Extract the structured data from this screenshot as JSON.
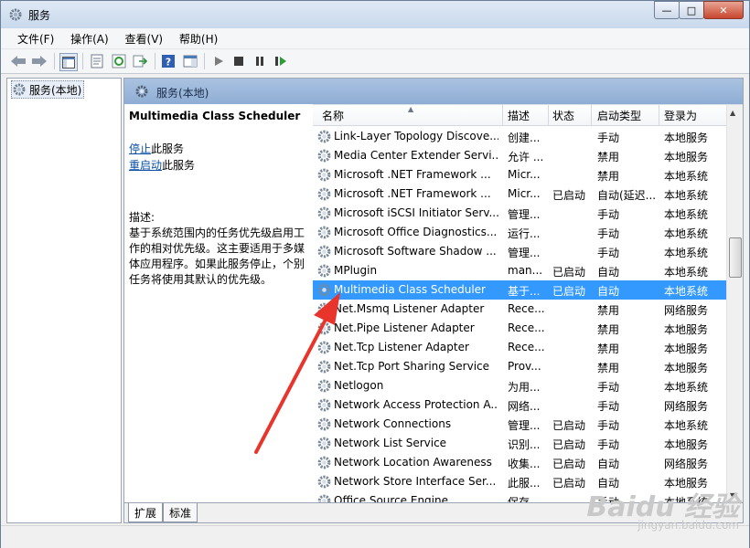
{
  "window": {
    "title": "服务",
    "minimize": "—",
    "maximize": "□",
    "close": "✕"
  },
  "menu": [
    "文件(F)",
    "操作(A)",
    "查看(V)",
    "帮助(H)"
  ],
  "tree": {
    "root": "服务(本地)"
  },
  "pane_header": "服务(本地)",
  "selected": {
    "title": "Multimedia Class Scheduler",
    "stop_link": "停止",
    "stop_suffix": "此服务",
    "restart_link": "重启动",
    "restart_suffix": "此服务",
    "desc_label": "描述:",
    "desc_text": "基于系统范围内的任务优先级启用工作的相对优先级。这主要适用于多媒体应用程序。如果此服务停止，个别任务将使用其默认的优先级。"
  },
  "columns": {
    "name": "名称",
    "desc": "描述",
    "status": "状态",
    "startup": "启动类型",
    "logon": "登录为"
  },
  "rows": [
    {
      "name": "Link-Layer Topology Discove...",
      "desc": "创建...",
      "status": "",
      "startup": "手动",
      "logon": "本地服务"
    },
    {
      "name": "Media Center Extender Servi...",
      "desc": "允许 ...",
      "status": "",
      "startup": "禁用",
      "logon": "本地服务"
    },
    {
      "name": "Microsoft .NET Framework ...",
      "desc": "Micr...",
      "status": "",
      "startup": "禁用",
      "logon": "本地系统"
    },
    {
      "name": "Microsoft .NET Framework ...",
      "desc": "Micr...",
      "status": "已启动",
      "startup": "自动(延迟...",
      "logon": "本地系统"
    },
    {
      "name": "Microsoft iSCSI Initiator Serv...",
      "desc": "管理...",
      "status": "",
      "startup": "手动",
      "logon": "本地系统"
    },
    {
      "name": "Microsoft Office Diagnostics...",
      "desc": "运行...",
      "status": "",
      "startup": "手动",
      "logon": "本地系统"
    },
    {
      "name": "Microsoft Software Shadow ...",
      "desc": "管理...",
      "status": "",
      "startup": "手动",
      "logon": "本地系统"
    },
    {
      "name": "MPlugin",
      "desc": "man...",
      "status": "已启动",
      "startup": "自动",
      "logon": "本地系统"
    },
    {
      "name": "Multimedia Class Scheduler",
      "desc": "基于...",
      "status": "已启动",
      "startup": "自动",
      "logon": "本地系统"
    },
    {
      "name": "Net.Msmq Listener Adapter",
      "desc": "Rece...",
      "status": "",
      "startup": "禁用",
      "logon": "网络服务"
    },
    {
      "name": "Net.Pipe Listener Adapter",
      "desc": "Rece...",
      "status": "",
      "startup": "禁用",
      "logon": "本地服务"
    },
    {
      "name": "Net.Tcp Listener Adapter",
      "desc": "Rece...",
      "status": "",
      "startup": "禁用",
      "logon": "本地服务"
    },
    {
      "name": "Net.Tcp Port Sharing Service",
      "desc": "Prov...",
      "status": "",
      "startup": "禁用",
      "logon": "本地服务"
    },
    {
      "name": "Netlogon",
      "desc": "为用...",
      "status": "",
      "startup": "手动",
      "logon": "本地系统"
    },
    {
      "name": "Network Access Protection A...",
      "desc": "网络...",
      "status": "",
      "startup": "手动",
      "logon": "网络服务"
    },
    {
      "name": "Network Connections",
      "desc": "管理...",
      "status": "已启动",
      "startup": "手动",
      "logon": "本地系统"
    },
    {
      "name": "Network List Service",
      "desc": "识别...",
      "status": "已启动",
      "startup": "手动",
      "logon": "本地服务"
    },
    {
      "name": "Network Location Awareness",
      "desc": "收集...",
      "status": "已启动",
      "startup": "自动",
      "logon": "网络服务"
    },
    {
      "name": "Network Store Interface Ser...",
      "desc": "此服...",
      "status": "已启动",
      "startup": "自动",
      "logon": "本地服务"
    },
    {
      "name": "Office Source Engine",
      "desc": "保存...",
      "status": "",
      "startup": "手动",
      "logon": "本地系统"
    }
  ],
  "selected_row_index": 8,
  "tabs": [
    "扩展",
    "标准"
  ],
  "watermark": {
    "brand": "Baidu 经验",
    "url": "jingyan.baidu.com"
  },
  "colors": {
    "selection": "#3399ff",
    "header": "#8fadd4",
    "annotation_arrow": "#e8342a"
  }
}
